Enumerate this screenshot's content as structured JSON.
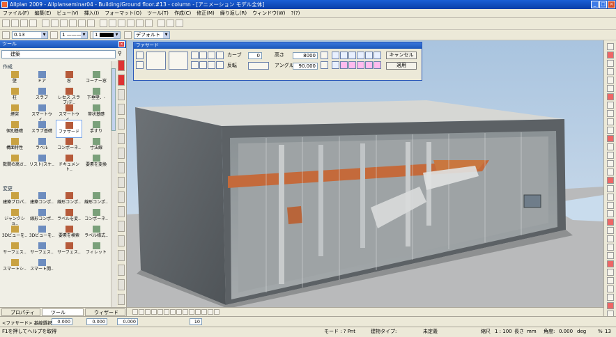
{
  "window": {
    "title": "Allplan 2009 - Allplanseminar04 - Building/Ground floor.#13 - column - [アニメーション モデル全体]"
  },
  "menu": [
    "ファイル(F)",
    "編集(E)",
    "ビュー(V)",
    "挿入(I)",
    "フォーマット(O)",
    "ツール(T)",
    "作成(C)",
    "修正(M)",
    "繰り返し(R)",
    "ウィンドウ(W)",
    "?(?)"
  ],
  "format_bar": {
    "pen": "0.13",
    "line": "1",
    "color": "1",
    "layer": "デフォルト"
  },
  "palette": {
    "title": "ツール",
    "module": "建築",
    "section_create": "作成",
    "section_modify": "変更",
    "create_tools": [
      "壁",
      "ドア",
      "窓",
      "コーナー窓",
      "柱",
      "スラブ",
      "レセス スラブ/デ..",
      "下垂壁、-",
      "煙突",
      "スマートウィ..",
      "スマートウィ..",
      "帯状基礎",
      "個別基礎",
      "スラブ基礎",
      "ファサード",
      "手すり",
      "構面特性",
      "ラベル",
      "コンポーネ..",
      "寸法線",
      "数間の高さ..",
      "リスト/スケ..",
      "ドキュメント..",
      "要素を変換"
    ],
    "modify_tools": [
      "建築プロパ..",
      "建築コンポ..",
      "線形コンポ..",
      "線形コンポ..",
      "ジャンクショ..",
      "線形コンポ..",
      "ラベルを変..",
      "コンポーネ..",
      "3Dビューを..",
      "3Dビューを..",
      "要素を検索",
      "ラベル様式..",
      "サーフェス..",
      "サーフェス..",
      "サーフェス..",
      "フィレット",
      "スマートシ..",
      "スマート開.."
    ],
    "tabs": [
      "プロパティ",
      "ツール",
      "ウィザード"
    ],
    "selected_tool": "ファサード"
  },
  "facade": {
    "title": "ファサード",
    "curve_label": "カーブ",
    "curve_value": "0",
    "height_label": "高さ",
    "height_value": "8000",
    "rotate_label": "反転",
    "angle_label": "アングル",
    "angle_value": "90.000",
    "cancel_label": "キャンセル",
    "apply_label": "適用"
  },
  "inputbar": {
    "label": "<ファサード> 基線選択..",
    "dx": "0.000",
    "dy": "0.000",
    "dz": "0.000",
    "grid": "10"
  },
  "status": {
    "help": "F1を押してヘルプを取得",
    "mode": "モード : ? Pnt",
    "build_type_label": "建物タイプ:",
    "build_type": "未定義",
    "scale_label": "縮尺",
    "scale": "1 : 100",
    "length_label": "長さ",
    "length": "mm",
    "angle_label": "角度:",
    "angle": "0.000",
    "unit": "deg",
    "percent": "%",
    "pct_value": "13"
  },
  "colors": {
    "titlebar": "#1b5fd6",
    "accent_red": "#d33",
    "brick": "#c46a3b"
  }
}
